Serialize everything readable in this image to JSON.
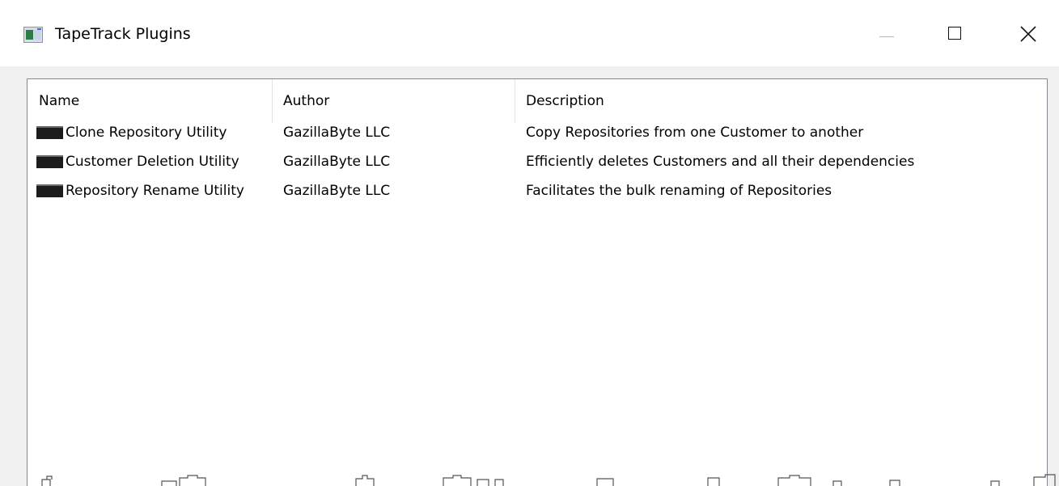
{
  "window": {
    "title": "TapeTrack Plugins",
    "icon": "tapetrack-app-icon",
    "controls": [
      "minimize",
      "maximize",
      "close"
    ]
  },
  "plugins_list": {
    "columns": [
      "Name",
      "Author",
      "Description"
    ],
    "rows": [
      {
        "name": "Clone Repository Utility",
        "author": "GazillaByte LLC",
        "description": "Copy Repositories from one Customer to another",
        "icon": "plugin-icon"
      },
      {
        "name": "Customer Deletion Utility",
        "author": "GazillaByte LLC",
        "description": "Efficiently deletes Customers and all their dependencies",
        "icon": "plugin-icon"
      },
      {
        "name": "Repository Rename Utility",
        "author": "GazillaByte LLC",
        "description": "Facilitates the bulk renaming of Repositories",
        "icon": "plugin-icon"
      }
    ]
  },
  "colors": {
    "window_bg": "#f0f0f0",
    "titlebar_bg": "#ffffff",
    "list_border": "#828790",
    "text": "#000000"
  }
}
